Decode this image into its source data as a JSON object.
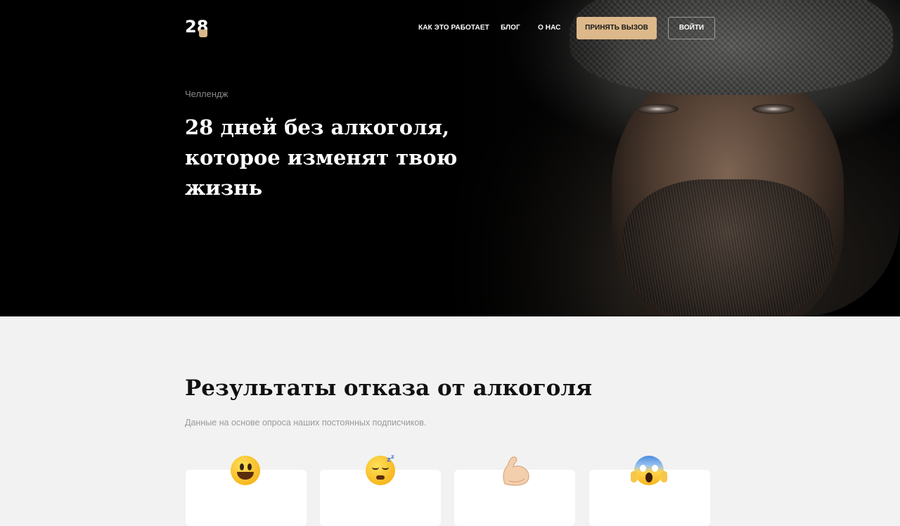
{
  "nav": {
    "logo_text": "28",
    "links": [
      "КАК ЭТО РАБОТАЕТ",
      "БЛОГ",
      "О НАС"
    ],
    "cta_label": "ПРИНЯТЬ ВЫЗОВ",
    "login_label": "ВОЙТИ"
  },
  "hero": {
    "eyebrow": "Челлендж",
    "title_line1": "28 дней без алкоголя,",
    "title_line2": "которое изменят твою",
    "title_line3": "жизнь"
  },
  "results": {
    "title": "Результаты отказа от алкоголя",
    "subtitle": "Данные на основе опроса наших постоянных подписчиков.",
    "cards": [
      {
        "icon": "grinning-face-icon"
      },
      {
        "icon": "sleeping-face-icon"
      },
      {
        "icon": "flexed-biceps-icon"
      },
      {
        "icon": "screaming-face-icon"
      }
    ]
  },
  "colors": {
    "accent": "#dcb88a",
    "hero_bg": "#000000",
    "page_bg": "#f2f2f2"
  }
}
